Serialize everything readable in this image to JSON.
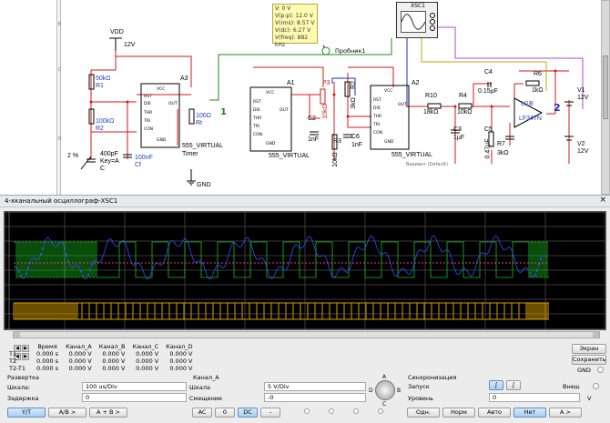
{
  "schematic": {
    "ruler_labels": [
      "B",
      "C",
      "D"
    ],
    "vdd": {
      "name": "VDD",
      "value": "12V"
    },
    "gnd": "GND",
    "probe": {
      "lines": [
        "V: 0 V",
        "V(p-p): 12.0 V",
        "V(rms): 8.57 V",
        "V(dc): 6.27 V",
        "V(freq): 882 kHz"
      ],
      "name": "Пробник1"
    },
    "xsc_label": "XSC1",
    "components": {
      "r1": {
        "value": "50kΩ",
        "name": "R1"
      },
      "r2": {
        "value": "100kΩ",
        "name": "R2"
      },
      "a3": {
        "name": "A3",
        "type": "555_VIRTUAL",
        "sub": "Timer"
      },
      "rt": {
        "value": "100Ω",
        "name": "Rt"
      },
      "pct": "2 %",
      "c_key": {
        "value": "400pF",
        "key": "Key=A",
        "name": "C"
      },
      "cf": {
        "value": "100nF",
        "name": "Cf"
      },
      "a1": {
        "name": "A1",
        "type": "555_VIRTUAL"
      },
      "p3": "P3",
      "pval": "10kΩ",
      "c2": {
        "name": "C2",
        "value": "1nF"
      },
      "r3": {
        "name": "R3",
        "value": "10kΩ"
      },
      "r2b": {
        "name": "R2",
        "value": "3kΩ"
      },
      "c6": {
        "name": "C6",
        "value": "1nF"
      },
      "a2": {
        "name": "A2",
        "type": "555_VIRTUAL",
        "sub": "Вариант (Default)"
      },
      "r10": {
        "name": "R10",
        "value": "18kΩ"
      },
      "r4": {
        "name": "R4",
        "value": "10kΩ"
      },
      "c4": {
        "name": "C4",
        "value": "0.15µF"
      },
      "c3": {
        "name": "C3",
        "value": "1µF"
      },
      "c5": {
        "name": "C5",
        "value": "0.47µF"
      },
      "r7": {
        "name": "R7",
        "value": "3kΩ"
      },
      "r6": {
        "name": "R6",
        "value": "1kΩ"
      },
      "u1b": {
        "name": "U1B",
        "type": "LF347N"
      },
      "v1": {
        "name": "V1",
        "value": "12V"
      },
      "v2": {
        "name": "V2",
        "value": "12V"
      },
      "node1": "1",
      "node2": "2"
    },
    "pins_555": [
      "VCC",
      "RST",
      "DIS",
      "THR",
      "TRI",
      "CON",
      "GND",
      "OUT"
    ]
  },
  "scope": {
    "title": "4-хканальный осциллограф-XSC1",
    "close": "×",
    "meas_headers": [
      "",
      "Время",
      "Канал_A",
      "Канал_B",
      "Канал_C",
      "Канал_D"
    ],
    "meas_rows": [
      [
        "T1",
        "0.000 s",
        "0.000 V",
        "0.000 V",
        "0.000 V",
        "0.000 V"
      ],
      [
        "T2",
        "0.000 s",
        "0.000 V",
        "0.000 V",
        "0.000 V",
        "0.000 V"
      ],
      [
        "T2-T1",
        "0.000 s",
        "0.000 V",
        "0.000 V",
        "0.000 V",
        "0.000 V"
      ]
    ],
    "buttons_right": {
      "screen": "Экран",
      "save": "Сохранить",
      "gnd": "GND"
    },
    "timebase": {
      "title": "Развертка",
      "scale_label": "Шкала:",
      "scale": "100 us/Div",
      "delay_label": "Задержка",
      "delay": "0"
    },
    "channel": {
      "title": "Канал_A",
      "scale_label": "Шкала",
      "scale": "5 V/Div",
      "offset_label": "Смещение",
      "offset": "-0"
    },
    "knob_labels": [
      "A",
      "B",
      "C",
      "D"
    ],
    "trigger": {
      "title": "Синхронизация",
      "start_label": "Запуск",
      "ext_label": "Внеш",
      "level_label": "Уровень",
      "level": "0",
      "unit": "V"
    },
    "mode_buttons": [
      "Y/T",
      "A/B >",
      "A + B >"
    ],
    "coupling": [
      "AC",
      "0",
      "DC",
      "-"
    ],
    "trig_buttons": [
      "Одн.",
      "Норм",
      "Авто",
      "Нет",
      "A >"
    ]
  }
}
